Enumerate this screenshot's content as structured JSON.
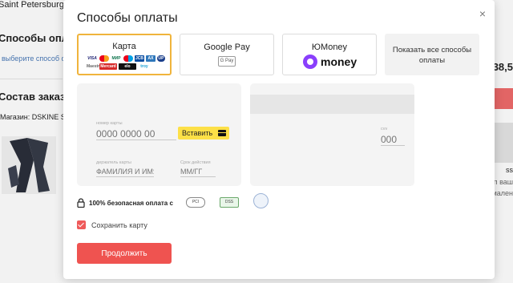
{
  "background": {
    "address": "Saint Petersburg, Sa",
    "payment_heading": "Способы оплат",
    "choose_method": "выберите способ опл",
    "order_heading": "Состав заказа",
    "store": "Магазин: DSKINE St",
    "price_fragment": "38,5",
    "right_fragment_1": "ss",
    "right_fragment_2": "п ваш",
    "right_fragment_3": "мален"
  },
  "modal": {
    "title": "Способы оплаты",
    "close_glyph": "×",
    "methods": {
      "card": {
        "label": "Карта"
      },
      "gpay": {
        "label": "Google Pay",
        "badge": "G Pay"
      },
      "yoomoney": {
        "label": "ЮMoney",
        "wordmark": "money"
      },
      "all": {
        "label": "Показать все способы оплаты"
      }
    },
    "card_logos": [
      "VISA",
      "MC",
      "МИР",
      "MC",
      "JCB",
      "AX",
      "UP",
      "Maestro",
      "Mercard",
      "elo",
      "troy"
    ],
    "card_front": {
      "number_label": "номер карты",
      "number_placeholder": "0000 0000 00",
      "insert_label": "Вставить",
      "holder_label": "держатель карты",
      "holder_placeholder": "ФАМИЛИЯ И ИМЯ",
      "expiry_label": "Срок действия",
      "expiry_placeholder": "ММ/ГГ"
    },
    "card_back": {
      "cvv_label": "cvv",
      "cvv_placeholder": "000"
    },
    "secure_text": "100% безопасная оплата с",
    "badges": [
      "PCI",
      "DSS"
    ],
    "save_card": "Сохранить карту",
    "continue": "Продолжить"
  },
  "colors": {
    "accent": "#ef5350",
    "active_border": "#f0b43c",
    "insert_button": "#fde047",
    "yoomoney": "#8a3ffc"
  }
}
